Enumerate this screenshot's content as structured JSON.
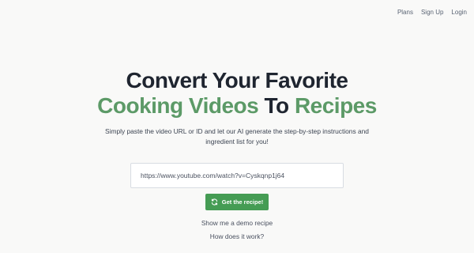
{
  "nav": {
    "items": [
      "Plans",
      "Sign Up",
      "Login"
    ]
  },
  "hero": {
    "title_line1": "Convert Your Favorite",
    "title_line2_part1": "Cooking Videos",
    "title_line2_part2": "To",
    "title_line2_part3": "Recipes",
    "subtitle": "Simply paste the video URL or ID and let our AI generate the step-by-step instructions and ingredient list for you!"
  },
  "form": {
    "url_value": "https://www.youtube.com/watch?v=Cyskqnp1j64",
    "submit_label": "Get the recipe!",
    "submit_icon": "refresh-icon"
  },
  "links": {
    "demo": "Show me a demo recipe",
    "how": "How does it work?"
  },
  "colors": {
    "accent_green": "#459c54",
    "title_green_dark": "#5c9a67",
    "title_green_light": "#6cc39a"
  }
}
